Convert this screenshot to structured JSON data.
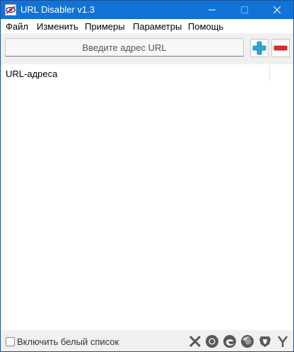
{
  "window": {
    "title": "URL Disabler v1.3",
    "titlebar_color": "#1273d6"
  },
  "menu": {
    "items": [
      {
        "label": "Файл"
      },
      {
        "label": "Изменить"
      },
      {
        "label": "Примеры"
      },
      {
        "label": "Параметры"
      },
      {
        "label": "Помощь"
      }
    ]
  },
  "toolbar": {
    "url_placeholder": "Введите адрес URL",
    "url_value": "",
    "add_icon": "plus-icon",
    "remove_icon": "minus-icon",
    "add_color": "#29a9d8",
    "remove_color": "#e02a2a"
  },
  "list": {
    "column_header": "URL-адреса",
    "rows": []
  },
  "statusbar": {
    "whitelist_label": "Включить белый список",
    "whitelist_checked": false,
    "browser_icons": [
      "close-all-icon",
      "chrome-icon",
      "edge-icon",
      "firefox-icon",
      "brave-icon",
      "yandex-icon"
    ]
  }
}
